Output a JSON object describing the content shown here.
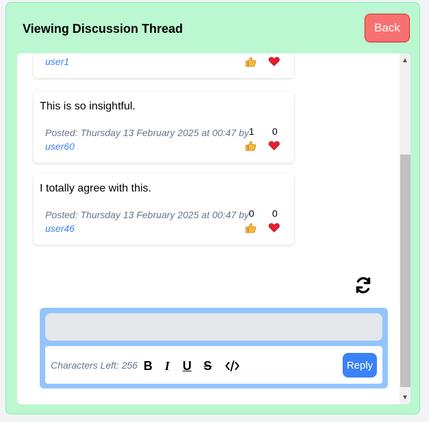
{
  "header": {
    "title": "Viewing Discussion Thread",
    "back_label": "Back"
  },
  "posts": [
    {
      "text": "",
      "posted": "",
      "user": "user1",
      "likes": "",
      "hearts": ""
    },
    {
      "text": "This is so insightful.",
      "posted": "Posted: Thursday 13 February 2025 at 00:47 by",
      "user": "user60",
      "likes": "1",
      "hearts": "0"
    },
    {
      "text": "I totally agree with this.",
      "posted": "Posted: Thursday 13 February 2025 at 00:47 by",
      "user": "user46",
      "likes": "0",
      "hearts": "0"
    }
  ],
  "composer": {
    "chars_left": "Characters Left: 256",
    "reply_label": "Reply"
  },
  "icons": {
    "like": "thumbs-up-icon",
    "heart": "heart-icon",
    "refresh": "refresh-icon",
    "bold": "bold-icon",
    "italic": "italic-icon",
    "underline": "underline-icon",
    "strike": "strikethrough-icon",
    "code": "code-icon"
  },
  "colors": {
    "panel": "#bbf7d0",
    "back": "#f87171",
    "reply": "#3b82f6",
    "composer": "#93c5fd"
  }
}
